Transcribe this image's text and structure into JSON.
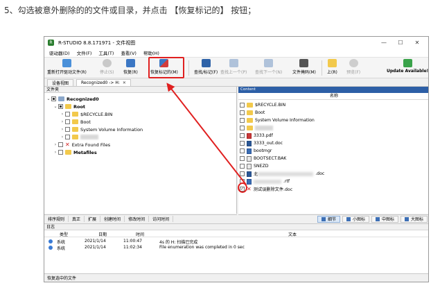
{
  "instruction": "5、勾选被意外删除的的文件或目录，并点击 【恢复标记的】 按钮；",
  "window": {
    "title": "R-STUDIO 8.8.171971 - 文件视图",
    "controls": [
      "—",
      "☐",
      "✕"
    ]
  },
  "menu": [
    "驱动器(D)",
    "文件(F)",
    "工具(T)",
    "查看(V)",
    "帮助(H)"
  ],
  "toolbar": {
    "rescan": "重新打开驱动文件(R)",
    "stop": "停止(S)",
    "recover": "恢复(R)",
    "recover_marked": "恢复标记的(M)",
    "find_mark": "查找/标记(F)",
    "find_prev": "查找上一个(P)",
    "find_next": "查找下一个(N)",
    "file_mask": "文件掩码(M)",
    "up": "上(R)",
    "preview": "预览(F)",
    "update": "Update Available!"
  },
  "tabs": {
    "device_view": "设备视图",
    "recognized": "Recognized0 -> H:"
  },
  "left_pane": {
    "header": "文件夹",
    "tree": {
      "recognized": "Recognized0",
      "root": "Root",
      "recycle": "$RECYCLE.BIN",
      "boot": "Boot",
      "svi": "System Volume Information",
      "extra": "Extra Found Files",
      "metafiles": "Metafiles"
    }
  },
  "right_pane": {
    "header": "Content",
    "column": "名称",
    "files": [
      {
        "name": "$RECYCLE.BIN"
      },
      {
        "name": "Boot"
      },
      {
        "name": "System Volume Information"
      },
      {
        "name": ""
      },
      {
        "name": "3333.pdf"
      },
      {
        "name": "3333_out.doc"
      },
      {
        "name": "bootmgr"
      },
      {
        "name": "BOOTSECT.BAK"
      },
      {
        "name": "SNEZD"
      },
      {
        "name": "北.doc",
        "prefix": "北",
        "suffix": ".doc"
      },
      {
        "name": ".rtf",
        "prefix": "",
        "suffix": ".rtf"
      },
      {
        "name": "测试误删除文件.doc"
      }
    ]
  },
  "sort_tabs": [
    "排序规则",
    "真正",
    "扩展",
    "创建时间",
    "修改时间",
    "访问时间"
  ],
  "view_tabs": {
    "detail": "细节",
    "small": "小图标",
    "medium": "中图标",
    "large": "大图标"
  },
  "log": {
    "title": "日志",
    "headers": {
      "type": "类型",
      "date": "日期",
      "time": "时间",
      "text": "文本"
    },
    "rows": [
      {
        "type": "系统",
        "date": "2021/1/14",
        "time": "11:00:47",
        "text": "4s 的 H: 扫描已完成"
      },
      {
        "type": "系统",
        "date": "2021/1/14",
        "time": "11:02:34",
        "text": "File enumeration was completed in 0 sec"
      }
    ]
  },
  "status": "恢复选中的文件",
  "colors": {
    "highlight_red": "#e02020",
    "content_header": "#2d5fa6",
    "folder": "#f2c94c"
  }
}
